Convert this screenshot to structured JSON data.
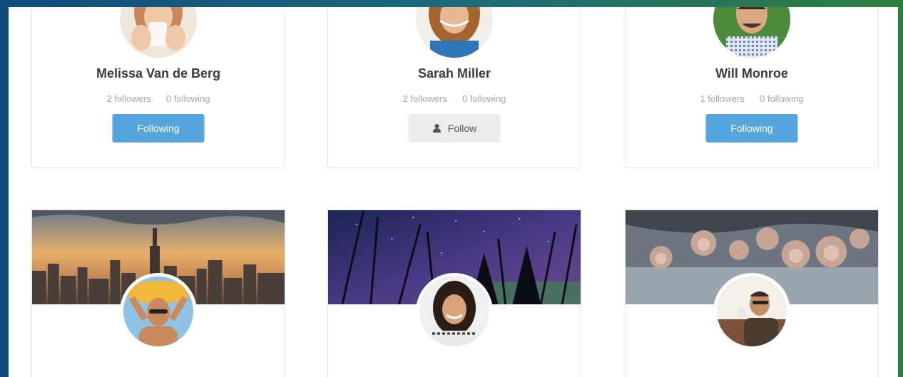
{
  "profiles": [
    {
      "name": "Melissa Van de Berg",
      "followers": "2",
      "followers_label": "followers",
      "following": "0",
      "following_label": "following",
      "button_label": "Following",
      "button_state": "following"
    },
    {
      "name": "Sarah Miller",
      "followers": "2",
      "followers_label": "followers",
      "following": "0",
      "following_label": "following",
      "button_label": "Follow",
      "button_state": "follow"
    },
    {
      "name": "Will Monroe",
      "followers": "1",
      "followers_label": "followers",
      "following": "0",
      "following_label": "following",
      "button_label": "Following",
      "button_state": "following"
    }
  ],
  "covers": [
    {
      "scene": "city-skyline-sunset"
    },
    {
      "scene": "starry-night-forest"
    },
    {
      "scene": "snow-monkeys-hot-spring"
    }
  ],
  "colors": {
    "following_button": "#56a5de",
    "follow_button": "#ededed",
    "name_text": "#3a3a3a",
    "stats_text": "#a8a8a8"
  },
  "icons": {
    "follow": "user-icon"
  }
}
